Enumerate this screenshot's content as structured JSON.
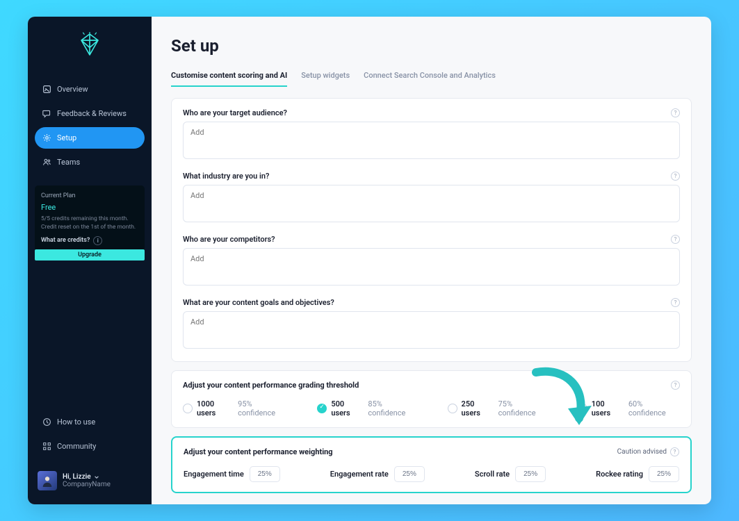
{
  "sidebar": {
    "items": [
      {
        "label": "Overview"
      },
      {
        "label": "Feedback & Reviews"
      },
      {
        "label": "Setup"
      },
      {
        "label": "Teams"
      }
    ],
    "bottom_items": [
      {
        "label": "How to use"
      },
      {
        "label": "Community"
      }
    ]
  },
  "plan": {
    "label": "Current Plan",
    "name": "Free",
    "meta": "5/5 credits remaining this month. Credit reset on the 1st of the month.",
    "credits_label": "What are credits?",
    "upgrade": "Upgrade"
  },
  "user": {
    "greeting": "Hi, Lizzie",
    "company": "CompanyName"
  },
  "page": {
    "title": "Set up"
  },
  "tabs": [
    {
      "label": "Customise content scoring and AI",
      "active": true
    },
    {
      "label": "Setup widgets",
      "active": false
    },
    {
      "label": "Connect Search Console and Analytics",
      "active": false
    }
  ],
  "questions": [
    {
      "label": "Who are your target audience?",
      "placeholder": "Add"
    },
    {
      "label": "What industry are you in?",
      "placeholder": "Add"
    },
    {
      "label": "Who are your competitors?",
      "placeholder": "Add"
    },
    {
      "label": "What are your content goals and objectives?",
      "placeholder": "Add"
    }
  ],
  "threshold": {
    "title": "Adjust your content performance grading threshold",
    "options": [
      {
        "main": "1000 users",
        "sub": "95% confidence",
        "selected": false
      },
      {
        "main": "500 users",
        "sub": "85% confidence",
        "selected": true
      },
      {
        "main": "250 users",
        "sub": "75% confidence",
        "selected": false
      },
      {
        "main": "100 users",
        "sub": "60% confidence",
        "selected": false
      }
    ]
  },
  "weighting": {
    "title": "Adjust your content performance weighting",
    "caution": "Caution advised",
    "items": [
      {
        "label": "Engagement time",
        "value": "25%"
      },
      {
        "label": "Engagement rate",
        "value": "25%"
      },
      {
        "label": "Scroll rate",
        "value": "25%"
      },
      {
        "label": "Rockee rating",
        "value": "25%"
      }
    ]
  }
}
